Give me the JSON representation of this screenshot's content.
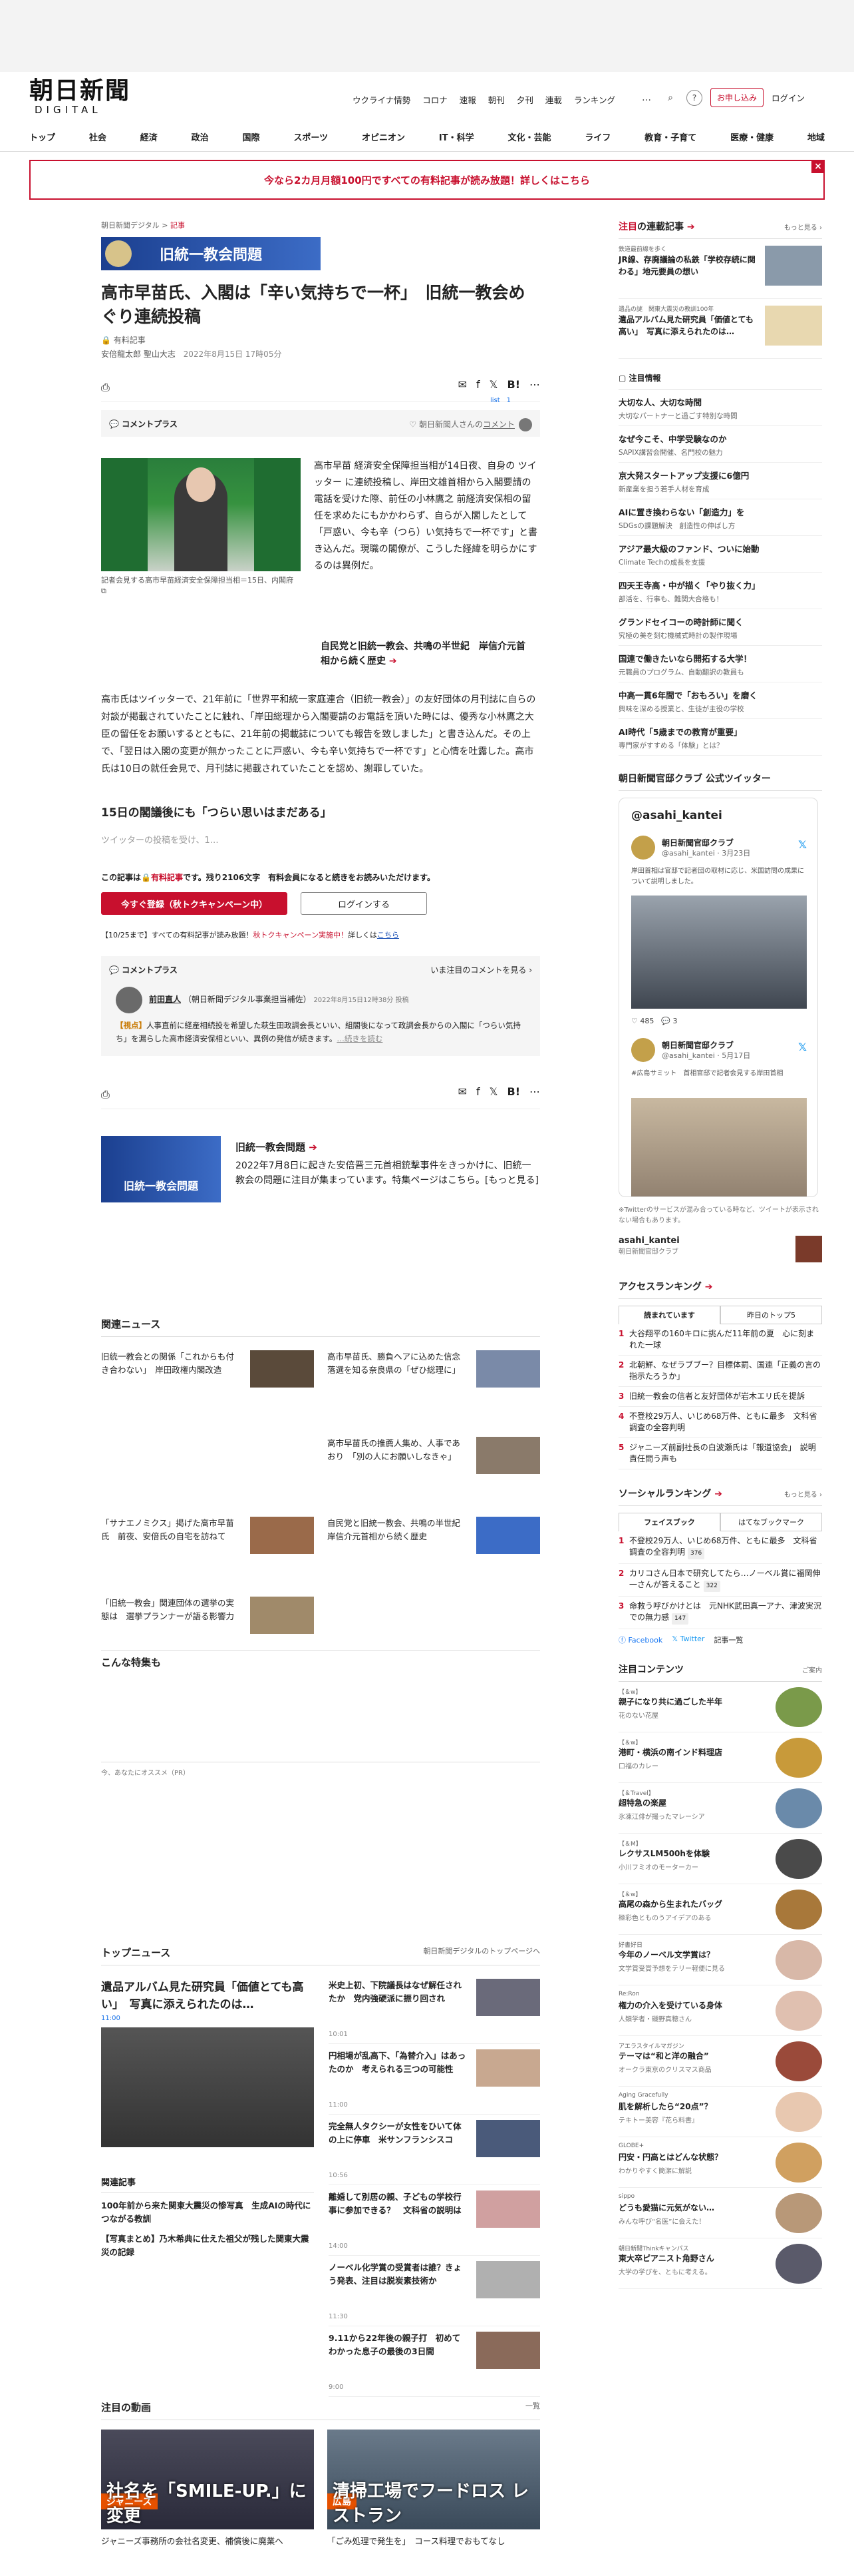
{
  "header": {
    "logo_jp": "朝日新聞",
    "logo_en": "DIGITAL",
    "topnav": [
      "ウクライナ情勢",
      "コロナ",
      "速報",
      "朝刊",
      "夕刊",
      "連載",
      "ランキング"
    ],
    "more": "…",
    "subscribe": "お申し込み",
    "login": "ログイン",
    "mainnav": [
      "トップ",
      "社会",
      "経済",
      "政治",
      "国際",
      "スポーツ",
      "オピニオン",
      "IT・科学",
      "文化・芸能",
      "ライフ",
      "教育・子育て",
      "医療・健康",
      "地域"
    ]
  },
  "banner": {
    "text": "今なら2カ月月額100円ですべての有料記事が読み放題！詳しくはこちら",
    "close": "×"
  },
  "article": {
    "crumb_site": "朝日新聞デジタル",
    "crumb_sep": ">",
    "crumb_section": "記事",
    "series": "旧統一教会問題",
    "title": "高市早苗氏、入閣は「辛い気持ちで一杯」　旧統一教会めぐり連続投稿",
    "tag": "有料記事",
    "authors": "安倍龍太郎 聖山大志",
    "date": "2022年8月15日 17時05分",
    "share_count": "list　1",
    "comment_plus": "コメントプラス",
    "comment_by": "朝日新聞人さんの",
    "comment_link": "コメント",
    "photo_caption": "記者会見する高市早苗経済安全保障担当相＝15日、内閣府",
    "lead": "高市早苗 経済安全保障担当相が14日夜、自身の ツイッター に連続投稿し、岸田文雄首相から入閣要請の電話を受けた際、前任の小林鷹之 前経済安保相の留任を求めたにもかかわらず、自らが入閣したとして「戸惑い、今も辛（つら）い気持ちで一杯です」と書き込んだ。現職の閣僚が、こうした経緯を明らかにするのは異例だ。",
    "related_link": "自民党と旧統一教会、共鳴の半世紀　岸信介元首相から続く歴史",
    "body": "高市氏はツイッターで、21年前に「世界平和統一家庭連合（旧統一教会）」の友好団体の月刊誌に自らの対談が掲載されていたことに触れ、「岸田総理から入閣要請のお電話を頂いた時には、優秀な小林鷹之大臣の留任をお願いするとともに、21年前の掲載誌についても報告を致しました」と書き込んだ。その上で、「翌日は入閣の変更が無かったことに戸惑い、今も辛い気持ちで一杯です」と心情を吐露した。高市氏は10日の就任会見で、月刊誌に掲載されていたことを認め、謝罪していた。",
    "h2": "15日の閣議後にも「つらい思いはまだある」",
    "fade": "ツイッターの投稿を受け、1…",
    "paid_prefix": "この記事は",
    "paid_mid": "有料記事",
    "paid_suffix": "です。残り2106文字　有料会員になると続きをお読みいただけます。",
    "btn_register": "今すぐ登録（秋トクキャンペーン中）",
    "btn_login": "ログインする",
    "notice_prefix": "【10/25まで】すべての有料記事が読み放題！",
    "notice_red": "秋トクキャンペーン実施中！",
    "notice_mid": "詳しくは",
    "notice_link": "こちら",
    "cbox_title": "コメントプラス",
    "cbox_right": "いま注目のコメントを見る",
    "commenter": "前田直人",
    "commenter_role": "（朝日新聞デジタル事業担当補佐）",
    "commenter_date": "2022年8月15日12時38分 投稿",
    "comment_tag": "【視点】",
    "comment_text": "人事直前に経産相続投を希望した萩生田政調会長といい、組閣後になって政調会長からの入閣に「つらい気持ち」を漏らした高市経済安保相といい、異例の発信が続きます。",
    "comment_more": "…続きを読む",
    "promo_title": "旧統一教会問題",
    "promo_text": "2022年7月8日に起きた安倍晋三元首相銃撃事件をきっかけに、旧統一教会の問題に注目が集まっています。特集ページはこちら。[もっと見る]",
    "promo_img": "旧統一教会問題"
  },
  "related": {
    "title": "関連ニュース",
    "items": [
      "旧統一教会との関係「これからも付き合わない」　岸田政権内閣改造",
      "高市早苗氏、勝負ヘアに込めた信念　落選を知る奈良県の「ぜひ総理に」",
      "高市早苗氏の推薦人集め、人事であおり　「別の人にお願いしなきゃ」",
      "「サナエノミクス」掲げた高市早苗氏　前夜、安倍氏の自宅を訪ねて",
      "自民党と旧統一教会、共鳴の半世紀　岸信介元首相から続く歴史",
      "「旧統一教会」関連団体の選挙の実態は　選挙プランナーが語る影響力"
    ]
  },
  "konna": "こんな特集も",
  "osusume": "今、あなたにオススメ（PR）",
  "topnews": {
    "title": "トップニュース",
    "right": "朝日新聞デジタルのトップページへ",
    "main_title": "遺品アルバム見た研究員「価値とても高い」　写真に添えられたのは…",
    "main_time": "11:00",
    "kanren": "関連記事",
    "kanren_items": [
      "100年前から来た関東大震災の惨写真　生成AIの時代につながる教訓",
      "【写真まとめ】乃木希典に仕えた祖父が残した関東大震災の記録"
    ],
    "list": [
      {
        "t": "米史上初、下院議長はなぜ解任されたか　党内強硬派に振り回され",
        "tm": "10:01"
      },
      {
        "t": "円相場が乱高下、「為替介入」はあったのか　考えられる三つの可能性",
        "tm": "11:00"
      },
      {
        "t": "完全無人タクシーが女性をひいて体の上に停車　米サンフランシスコ",
        "tm": "10:56"
      },
      {
        "t": "離婚して別居の親、子どもの学校行事に参加できる？　文科省の説明は",
        "tm": "14:00"
      },
      {
        "t": "ノーベル化学賞の受賞者は誰？きょう発表、注目は脱炭素技術か",
        "tm": "11:30"
      },
      {
        "t": "9.11から22年後の親子打　初めてわかった息子の最後の3日間",
        "tm": "9:00"
      }
    ]
  },
  "videos": {
    "title": "注目の動画",
    "right": "一覧",
    "items": [
      {
        "lab": "ジャニーズ",
        "big": "社名を「SMILE-UP.」に変更",
        "cap": "ジャニーズ事務所の会社名変更、補償後に廃業へ"
      },
      {
        "lab": "広島",
        "big": "清掃工場でフードロス レストラン",
        "cap": "「ごみ処理で発生を」　コース料理でおもてなし"
      }
    ]
  },
  "sidebar": {
    "chumoku": "注目",
    "chumoku2": "の連載記事",
    "more": "もっと見る",
    "items": [
      {
        "lb": "鉄道最前線を歩く",
        "t": "JR線、存廃議論の私鉄「学校存続に関わる」地元要員の想い"
      },
      {
        "lb": "遺品の謎　関東大震災の教訓100年",
        "t": "遺品アルバム見た研究員「価値とても高い」　写真に添えられたのは…"
      }
    ],
    "ad_hdr": "注目情報",
    "ads": [
      {
        "t": "大切な人、大切な時間",
        "s": "大切なパートナーと過ごす特別な時間"
      },
      {
        "t": "なぜ今こそ、中学受験なのか",
        "s": "SAPIX講習会開催、名門校の魅力"
      },
      {
        "t": "京大発スタートアップ支援に6億円",
        "s": "新産業を担う若手人材を育成"
      },
      {
        "t": "AIに置き換わらない「創造力」を",
        "s": "SDGsの課題解決　創造性の伸ばし方"
      },
      {
        "t": "アジア最大級のファンド、ついに始動",
        "s": "Climate Techの成長を支援"
      },
      {
        "t": "四天王寺高・中が描く「やり抜く力」",
        "s": "部活を、行事も、難関大合格も！"
      },
      {
        "t": "グランドセイコーの時計師に聞く",
        "s": "究極の美を刻む機械式時計の製作現場"
      },
      {
        "t": "国連で働きたいなら開拓する大学！",
        "s": "元職員のプログラム、自動翻訳の教員も"
      },
      {
        "t": "中高一貫6年間で「おもろい」を磨く",
        "s": "興味を深める授業と、生徒が主役の学校"
      },
      {
        "t": "AI時代「5歳までの教育が重要」",
        "s": "専門家がすすめる「体験」とは？"
      }
    ],
    "tw_hdr": "朝日新聞官邸クラブ 公式ツイッター",
    "tw_handle": "@asahi_kantei",
    "tweets": [
      {
        "nm": "朝日新聞官邸クラブ",
        "hd": "@asahi_kantei · 3月23日",
        "tx": "岸田首相は官邸で記者団の取材に応じ、米国訪問の成果について説明しました。",
        "ft": "♡ 485　💬 3"
      },
      {
        "nm": "朝日新聞官邸クラブ",
        "hd": "@asahi_kantei · 5月17日",
        "tx": "#広島サミット　首相官邸で記者会見する岸田首相",
        "ft": ""
      }
    ],
    "tw_note": "※Twitterのサービスが混み合っている時など、ツイートが表示されない場合もあります。",
    "acct_name": "asahi_kantei",
    "acct_sub": "朝日新聞官邸クラブ",
    "access_h": "アクセスランキング",
    "access_tabs": [
      "読まれています",
      "昨日のトップ5"
    ],
    "access": [
      "大谷翔平の160キロに挑んだ11年前の夏　心に刻まれた一球",
      "北朝鮮、なぜラブブー？目標体罰、国連「正義の言の指示たろうか」",
      "旧統一教会の信者と友好団体が岩木エリ氏を提訴",
      "不登校29万人、いじめ68万件、ともに最多　文科省調査の全容判明",
      "ジャニーズ前副社長の白波瀬氏は「報道協会」　説明責任問う声も"
    ],
    "social_h": "ソーシャルランキング",
    "social_tabs": [
      "フェイスブック",
      "はてなブックマーク"
    ],
    "social": [
      {
        "t": "不登校29万人、いじめ68万件、ともに最多　文科省調査の全容判明",
        "c": "376"
      },
      {
        "t": "カリコさん日本で研究してたら…ノーベル賞に福岡伸一さんが答えること",
        "c": "322"
      },
      {
        "t": "命救う呼びかけとは　元NHK武田真一アナ、津波実況での無力感",
        "c": "147"
      }
    ],
    "fb": "Facebook",
    "tw": "Twitter",
    "kiji": "記事一覧",
    "content_h": "注目コンテンツ",
    "content_r": "ご案内",
    "contents": [
      {
        "lb": "【＆w】",
        "t": "親子になり共に過ごした半年",
        "s": "花のない花屋"
      },
      {
        "lb": "【＆w】",
        "t": "港町・横浜の南インド料理店",
        "s": "口福のカレー"
      },
      {
        "lb": "【＆Travel】",
        "t": "超特急の楽屋",
        "s": "氷凍江俳が撮ったマレーシア"
      },
      {
        "lb": "【＆M】",
        "t": "レクサスLM500hを体験",
        "s": "小川フミオのモーターカー"
      },
      {
        "lb": "【＆w】",
        "t": "高尾の森から生まれたバッグ",
        "s": "極彩色とものうアイデアのある"
      },
      {
        "lb": "好書好日",
        "t": "今年のノーベル文学賞は？",
        "s": "文学賞受賞予想をテリー軽便に見る"
      },
      {
        "lb": "Re:Ron",
        "t": "権力の介入を受けている身体",
        "s": "人類学者・磯野真穂さん"
      },
      {
        "lb": "アエラスタイルマガジン",
        "t": "テーマは“和と洋の融合”",
        "s": "オークラ東京のクリスマス商品"
      },
      {
        "lb": "Aging Gracefully",
        "t": "肌を解析したら“20点”？",
        "s": "テキトー美容『花ら料書』"
      },
      {
        "lb": "GLOBE+",
        "t": "円安・円高とはどんな状態？",
        "s": "わかりやすく簡潔に解説"
      },
      {
        "lb": "sippo",
        "t": "どうも愛猫に元気がない…",
        "s": "みんな呼び“名医”に会えた！"
      },
      {
        "lb": "朝日新聞Thinkキャンパス",
        "t": "東大卒ピアニスト角野さん",
        "s": "大学の学びを、ともに考える。"
      }
    ]
  },
  "colors": {
    "accent": "#c8102e",
    "series_blue": "#1b3f8f"
  }
}
